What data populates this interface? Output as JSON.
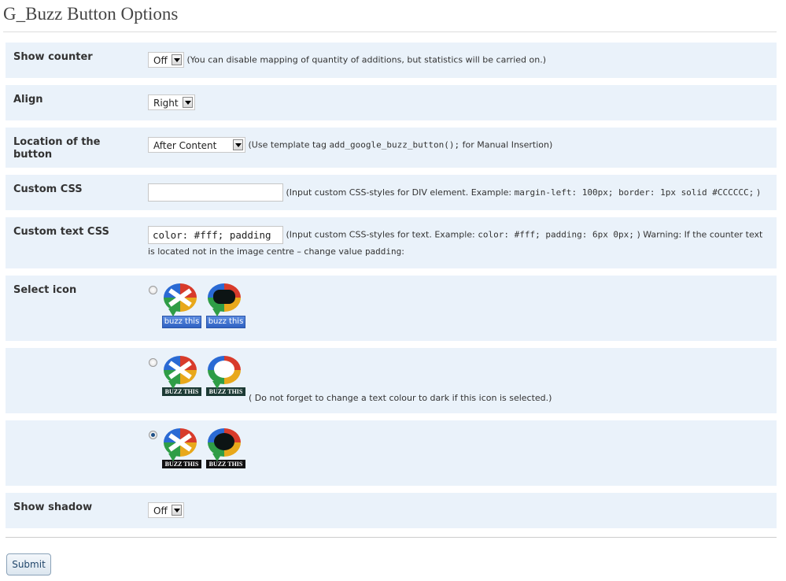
{
  "page": {
    "title": "G_Buzz Button Options"
  },
  "show_counter": {
    "label": "Show counter",
    "value": "Off",
    "hint": "(You can disable mapping of quantity of additions, but statistics will be carried on.)"
  },
  "align": {
    "label": "Align",
    "value": "Right"
  },
  "location": {
    "label": "Location of the button",
    "value": "After Content",
    "hint_prefix": "(Use template tag",
    "hint_code": "add_google_buzz_button();",
    "hint_suffix": "for Manual Insertion)"
  },
  "custom_css": {
    "label": "Custom CSS",
    "value": "",
    "hint_prefix": "(Input custom CSS-styles for DIV element. Example:",
    "hint_code": "margin-left: 100px; border: 1px solid #CCCCCC;",
    "hint_suffix": ")"
  },
  "custom_text_css": {
    "label": "Custom text CSS",
    "value": "color: #fff; padding",
    "hint_prefix": "(Input custom CSS-styles for text. Example:",
    "hint_code": "color: #fff; padding: 6px 0px;",
    "hint_mid": ") Warning: If the counter text is located not in the image centre – change value",
    "hint_code2": "padding",
    "hint_end": ":"
  },
  "select_icon": {
    "label": "Select icon",
    "options": [
      {
        "checked": false,
        "labels": [
          "buzz this",
          "buzz this"
        ],
        "note": ""
      },
      {
        "checked": false,
        "labels": [
          "BUZZ THIS",
          "BUZZ THIS"
        ],
        "note": "( Do not forget to change a text colour to dark if this icon is selected.)"
      },
      {
        "checked": true,
        "labels": [
          "BUZZ THIS",
          "BUZZ THIS"
        ],
        "note": ""
      }
    ]
  },
  "show_shadow": {
    "label": "Show shadow",
    "value": "Off"
  },
  "submit": {
    "label": "Submit"
  },
  "icons": {
    "dropdown_arrow": "chevron-down-icon",
    "buzz_color": "google-buzz-icon",
    "buzz_dark": "google-buzz-dark-icon"
  },
  "colors": {
    "row_background": "#eaf2fa",
    "radio_selected": "#1d4f86",
    "buzz_label_blue": "#2f62c3"
  }
}
